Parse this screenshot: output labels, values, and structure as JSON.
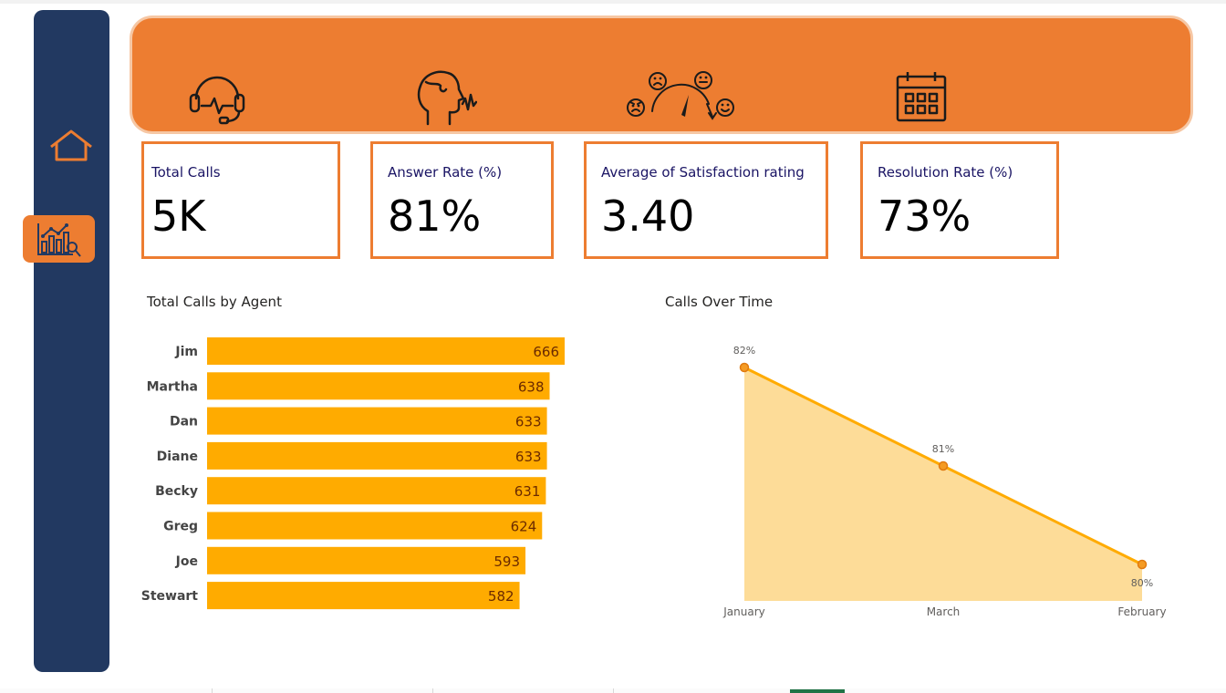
{
  "navigation": {
    "items": [
      {
        "icon": "home-icon"
      },
      {
        "icon": "analytics-icon",
        "active": true
      }
    ]
  },
  "banner": {
    "icons": [
      "headset-icon",
      "speaking-head-icon",
      "satisfaction-gauge-icon",
      "calendar-icon"
    ]
  },
  "kpis": [
    {
      "label": "Total Calls",
      "value": "5K"
    },
    {
      "label": "Answer Rate (%)",
      "value": "81%"
    },
    {
      "label": "Average of Satisfaction rating",
      "value": "3.40"
    },
    {
      "label": "Resolution Rate (%)",
      "value": "73%"
    }
  ],
  "colors": {
    "sidebar": "#223961",
    "accent": "#ed7d31",
    "bar": "#ffab00",
    "area_fill": "#fddc98",
    "line": "#ffab00",
    "marker": "#f59b23"
  },
  "chart_data": [
    {
      "type": "bar",
      "orientation": "horizontal",
      "title": "Total Calls by Agent",
      "categories": [
        "Jim",
        "Martha",
        "Dan",
        "Diane",
        "Becky",
        "Greg",
        "Joe",
        "Stewart"
      ],
      "values": [
        666,
        638,
        633,
        633,
        631,
        624,
        593,
        582
      ],
      "data_labels": true,
      "grid": false
    },
    {
      "type": "area",
      "title": "Calls Over Time",
      "x": [
        "January",
        "March",
        "February"
      ],
      "values": [
        82,
        81,
        80
      ],
      "data_labels": [
        "82%",
        "81%",
        "80%"
      ],
      "grid": false
    }
  ]
}
